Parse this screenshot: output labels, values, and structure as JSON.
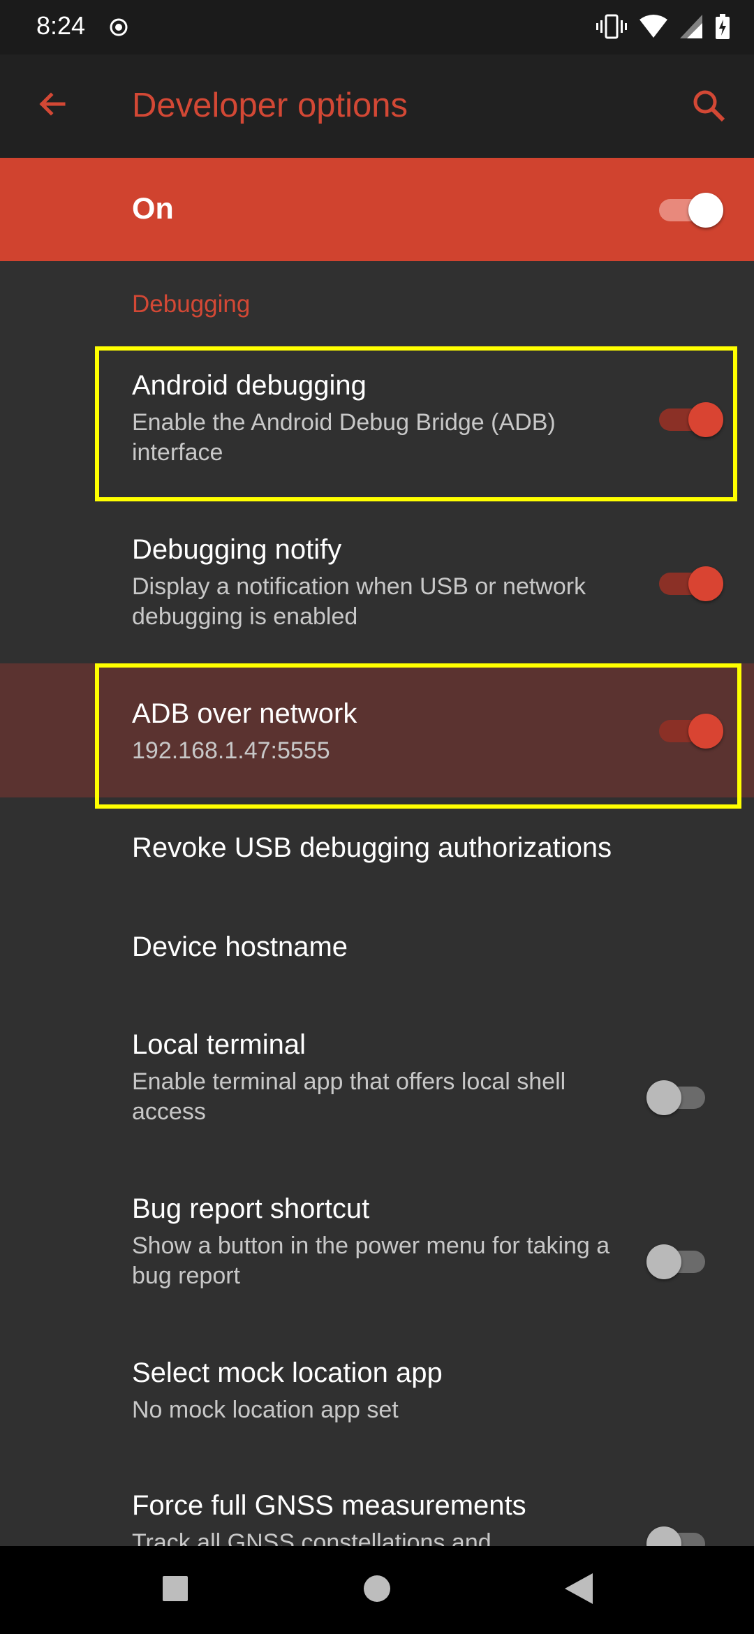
{
  "status_bar": {
    "time": "8:24",
    "icons": [
      "record-icon",
      "vibrate-icon",
      "wifi-icon",
      "cellular-signal-icon",
      "battery-icon"
    ]
  },
  "app_bar": {
    "title": "Developer options",
    "back_icon": "arrow-back-icon",
    "search_icon": "search-icon"
  },
  "master_switch": {
    "label": "On",
    "checked": true
  },
  "section": {
    "header": "Debugging"
  },
  "preferences": [
    {
      "title": "Android debugging",
      "summary": "Enable the Android Debug Bridge (ADB) interface",
      "switch": true
    },
    {
      "title": "Debugging notify",
      "summary": "Display a notification when USB or network debugging is enabled",
      "switch": true
    },
    {
      "title": "ADB over network",
      "summary": "192.168.1.47:5555",
      "switch": true
    },
    {
      "title": "Revoke USB debugging authorizations"
    },
    {
      "title": "Device hostname"
    },
    {
      "title": "Local terminal",
      "summary": "Enable terminal app that offers local shell access",
      "switch": false
    },
    {
      "title": "Bug report shortcut",
      "summary": "Show a button in the power menu for taking a bug report",
      "switch": false
    },
    {
      "title": "Select mock location app",
      "summary": "No mock location app set"
    },
    {
      "title": "Force full GNSS measurements",
      "summary": "Track all GNSS constellations and",
      "switch": false
    }
  ],
  "colors": {
    "accent": "#d34835",
    "master_bar": "#d0432f",
    "background": "#303030",
    "highlight_row": "#5b3330",
    "annotation_box": "#ffff00"
  },
  "nav_bar": {
    "icons": [
      "recents-square-icon",
      "home-circle-icon",
      "back-triangle-icon"
    ]
  }
}
